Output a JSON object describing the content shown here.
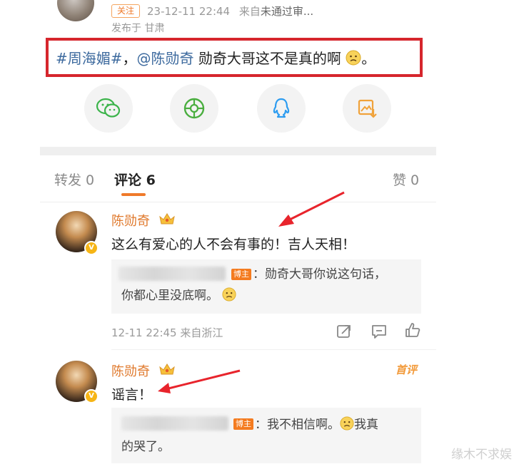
{
  "post": {
    "follow_label": "关注",
    "date_prefix": "23-12-11 22:44",
    "source_prefix": "来自",
    "source_name": "未通过审...",
    "location": "发布于 甘肃",
    "topic": "#周海媚#",
    "separator": "，",
    "mention": "@陈勋奇",
    "text": " 勋奇大哥这不是真的啊",
    "end": "。"
  },
  "share": {
    "items": [
      {
        "icon": "wechat-icon"
      },
      {
        "icon": "moments-icon"
      },
      {
        "icon": "qq-icon"
      },
      {
        "icon": "save-image-icon"
      }
    ]
  },
  "tabs": {
    "repost": "转发 0",
    "comments": "评论 6",
    "likes": "赞 0"
  },
  "comments": [
    {
      "author": "陈勋奇",
      "text": "这么有爱心的人不会有事的！吉人天相！",
      "reply_badge": "博主",
      "reply_text_1": "：勋奇大哥你说这句话，",
      "reply_text_2": "你都心里没底啊。",
      "time": "12-11 22:45 来自浙江"
    },
    {
      "author": "陈勋奇",
      "tag": "首评",
      "text": "谣言！",
      "reply_badge": "博主",
      "reply_text_1": "：我不相信啊。",
      "reply_text_1b": "我真",
      "reply_text_2": "的哭了。"
    }
  ],
  "watermark": "缘木不求娱",
  "colors": {
    "accent": "#ef7a2a",
    "highlight_border": "#d6262d",
    "link": "#3d6a9e",
    "arrow": "#e8242c"
  }
}
